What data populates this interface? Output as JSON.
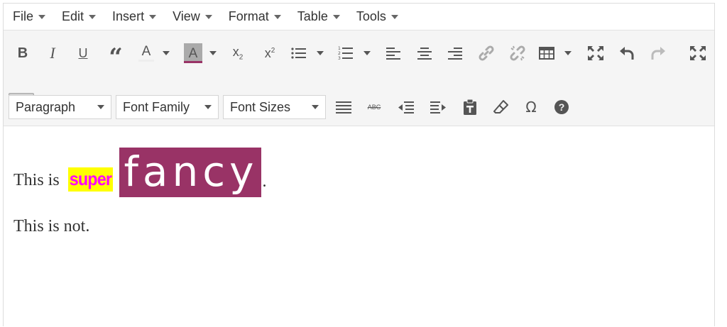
{
  "menubar": {
    "items": [
      {
        "label": "File"
      },
      {
        "label": "Edit"
      },
      {
        "label": "Insert"
      },
      {
        "label": "View"
      },
      {
        "label": "Format"
      },
      {
        "label": "Table"
      },
      {
        "label": "Tools"
      }
    ]
  },
  "toolbar": {
    "row1": [
      "bold-icon",
      "italic-icon",
      "underline-icon",
      "blockquote-icon",
      "text-color-icon",
      "background-color-icon",
      "subscript-icon",
      "superscript-icon",
      "bullet-list-icon",
      "numbered-list-icon",
      "align-left-icon",
      "align-center-icon",
      "align-right-icon",
      "link-icon",
      "unlink-icon",
      "table-icon",
      "fullscreen-icon",
      "undo-icon",
      "redo-icon",
      "distraction-free-icon"
    ],
    "text_color_letter": "A",
    "bg_color_letter": "A",
    "bg_color_swatch": "#993366",
    "bold_letter": "B",
    "italic_letter": "I",
    "underline_letter": "U",
    "quote_glyph": "“",
    "subscript_base": "x",
    "subscript_mark": "2",
    "superscript_base": "x",
    "superscript_mark": "2",
    "row2": {
      "format_select": "Paragraph",
      "font_family_select": "Font Family",
      "font_size_select": "Font Sizes",
      "strike_label": "ABC",
      "omega_glyph": "Ω",
      "help_glyph": "?"
    }
  },
  "content": {
    "line1_prefix": "This is ",
    "line1_super": "super",
    "line1_fancy": "fancy",
    "line1_suffix": ".",
    "line2": "This is not.",
    "super_bg": "#ffff00",
    "super_fg": "#ff00ff",
    "fancy_bg": "#993366",
    "fancy_fg": "#ffffff"
  }
}
